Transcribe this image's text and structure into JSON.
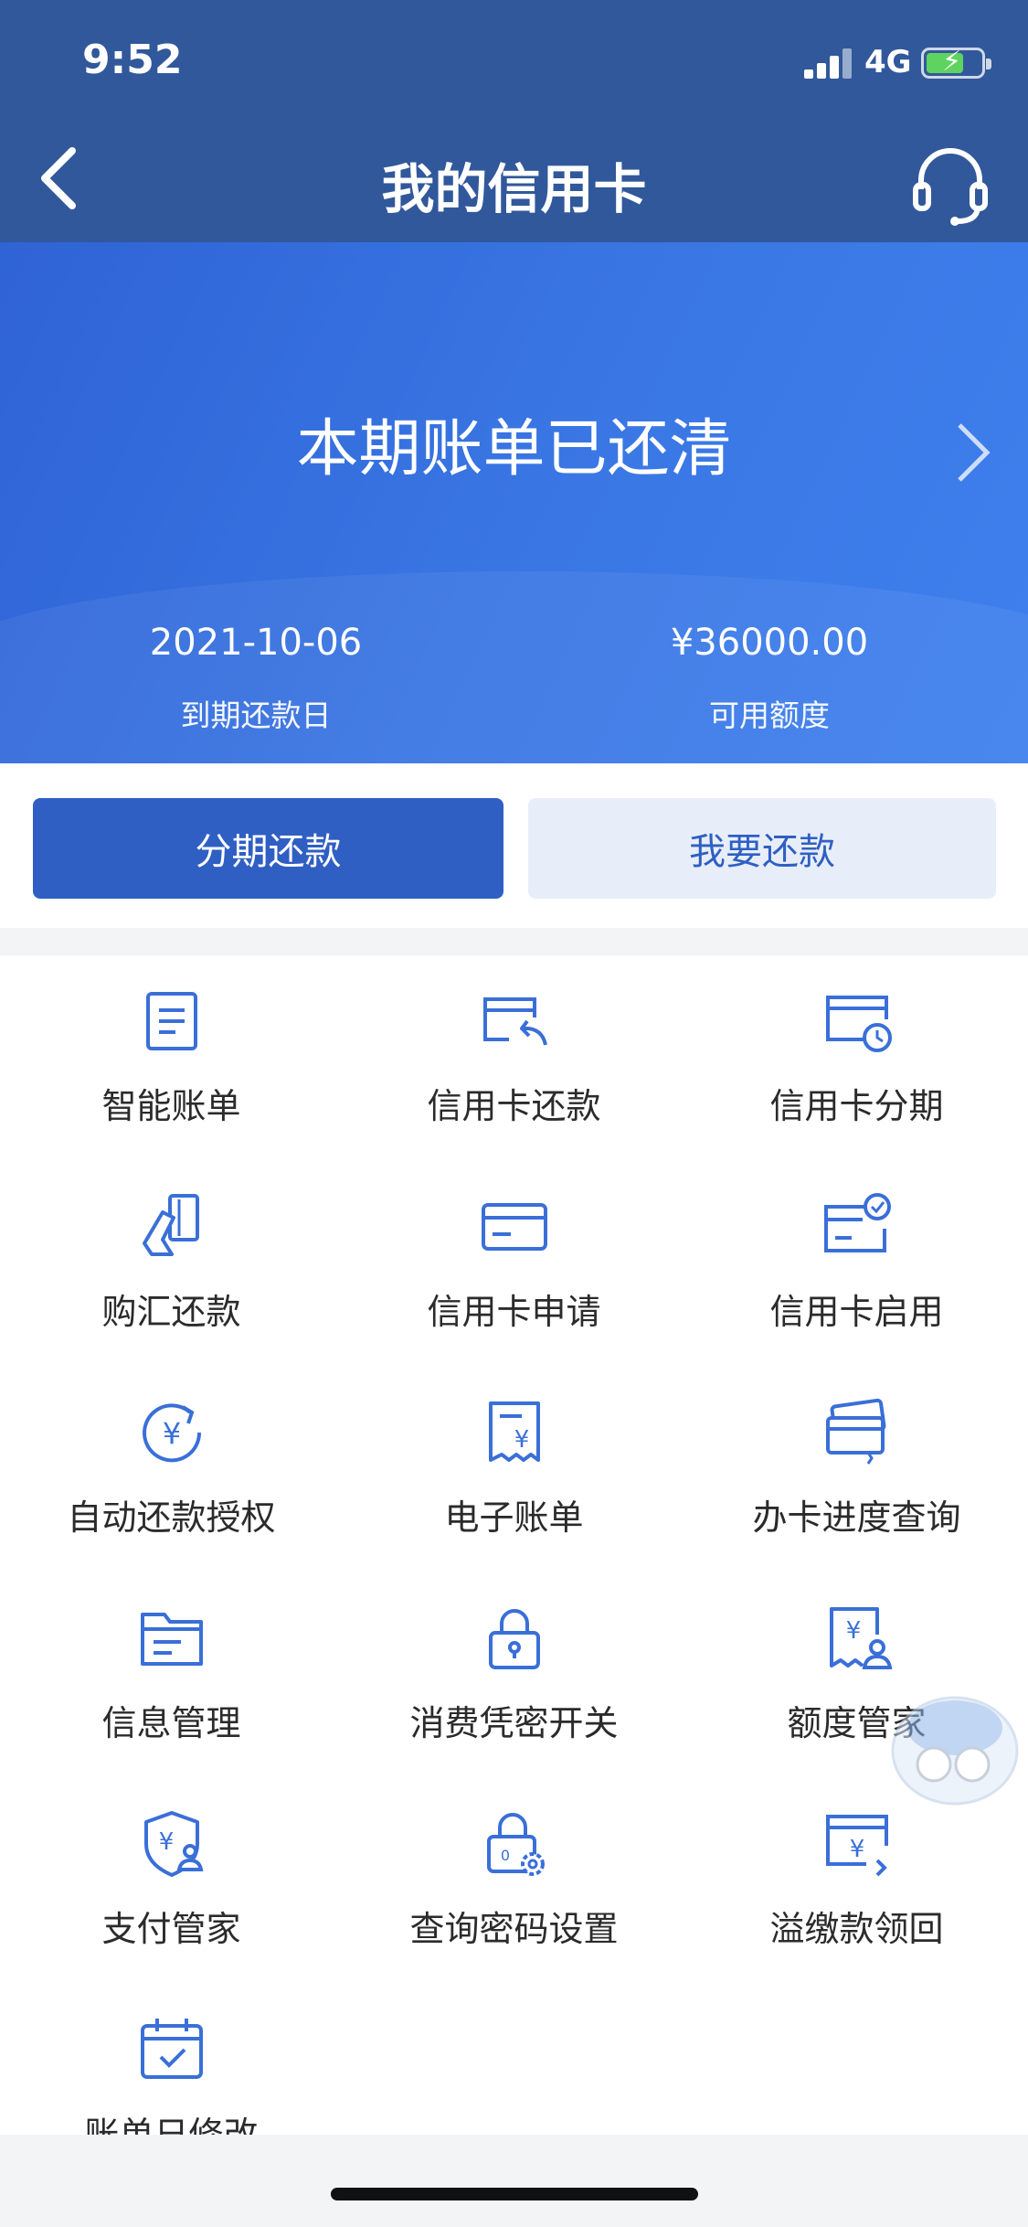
{
  "status_bar": {
    "time": "9:52",
    "network": "4G"
  },
  "header": {
    "title": "我的信用卡"
  },
  "hero": {
    "message": "本期账单已还清",
    "due_date": "2021-10-06",
    "due_date_label": "到期还款日",
    "available_credit": "¥36000.00",
    "available_credit_label": "可用额度"
  },
  "actions": {
    "installment": "分期还款",
    "repay": "我要还款"
  },
  "services": [
    {
      "label": "智能账单",
      "icon": "bill-icon"
    },
    {
      "label": "信用卡还款",
      "icon": "card-repay-icon"
    },
    {
      "label": "信用卡分期",
      "icon": "card-installment-icon"
    },
    {
      "label": "购汇还款",
      "icon": "fx-repay-icon"
    },
    {
      "label": "信用卡申请",
      "icon": "card-apply-icon"
    },
    {
      "label": "信用卡启用",
      "icon": "card-activate-icon"
    },
    {
      "label": "自动还款授权",
      "icon": "auto-repay-icon"
    },
    {
      "label": "电子账单",
      "icon": "e-bill-icon"
    },
    {
      "label": "办卡进度查询",
      "icon": "apply-progress-icon"
    },
    {
      "label": "信息管理",
      "icon": "folder-icon"
    },
    {
      "label": "消费凭密开关",
      "icon": "lock-icon"
    },
    {
      "label": "额度管家",
      "icon": "credit-manager-icon"
    },
    {
      "label": "支付管家",
      "icon": "payment-shield-icon"
    },
    {
      "label": "查询密码设置",
      "icon": "password-settings-icon"
    },
    {
      "label": "溢缴款领回",
      "icon": "overpayment-icon"
    },
    {
      "label": "账单日修改",
      "icon": "calendar-icon"
    }
  ]
}
